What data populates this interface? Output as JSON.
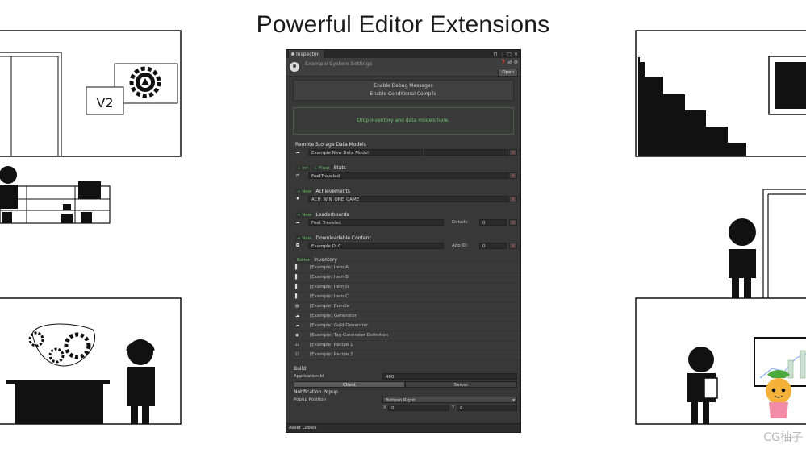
{
  "headline": "Powerful Editor Extensions",
  "scene": {
    "version_label": "V2"
  },
  "watermark": "CG柚子",
  "inspector": {
    "tab_label": "Inspector",
    "title": "Example System Settings",
    "open_label": "Open",
    "toggles": [
      "Enable Debug Messages",
      "Enable Conditional Compile"
    ],
    "dropzone_text": "Drop inventory and data models here.",
    "remote_storage": {
      "title": "Remote Storage Data Models",
      "item": "Example New Data Model"
    },
    "stats": {
      "add_int": "+ Int",
      "add_float": "+ Float",
      "title": "Stats",
      "item": "FeetTraveled"
    },
    "achievements": {
      "add": "+ New",
      "title": "Achievements",
      "item": "ACH_WIN_ONE_GAME"
    },
    "leaderboards": {
      "add": "+ New",
      "title": "Leaderboards",
      "item": "Feet Traveled",
      "details_label": "Details:",
      "details_value": "0"
    },
    "dlc": {
      "add": "+ New",
      "title": "Downloadable Content",
      "item": "Example DLC",
      "app_id_label": "App ID:",
      "app_id_value": "0"
    },
    "inventory": {
      "editor_label": "Editor",
      "title": "Inventory",
      "items": [
        {
          "icon": "file-icon",
          "name": "[Example] Item A"
        },
        {
          "icon": "file-icon",
          "name": "[Example] Item B"
        },
        {
          "icon": "file-icon",
          "name": "[Example] Item D"
        },
        {
          "icon": "file-icon",
          "name": "[Example] Item C"
        },
        {
          "icon": "bundle-icon",
          "name": "[Example] Bundle"
        },
        {
          "icon": "generator-icon",
          "name": "[Example] Generator"
        },
        {
          "icon": "generator-icon",
          "name": "[Example] Gold Generator"
        },
        {
          "icon": "tag-icon",
          "name": "[Example] Tag Generator Definition"
        },
        {
          "icon": "recipe-icon",
          "name": "[Example] Recipe 1"
        },
        {
          "icon": "recipe-icon",
          "name": "[Example] Recipe 2"
        }
      ]
    },
    "build": {
      "title": "Build",
      "app_id_label": "Application Id",
      "app_id_value": "480",
      "client_label": "Client",
      "server_label": "Server"
    },
    "notification": {
      "title": "Notification Popup",
      "position_label": "Popup Position",
      "position_value": "Bottom Right",
      "x_label": "X",
      "x_value": "0",
      "y_label": "Y",
      "y_value": "0"
    },
    "asset_labels": "Asset Labels"
  }
}
